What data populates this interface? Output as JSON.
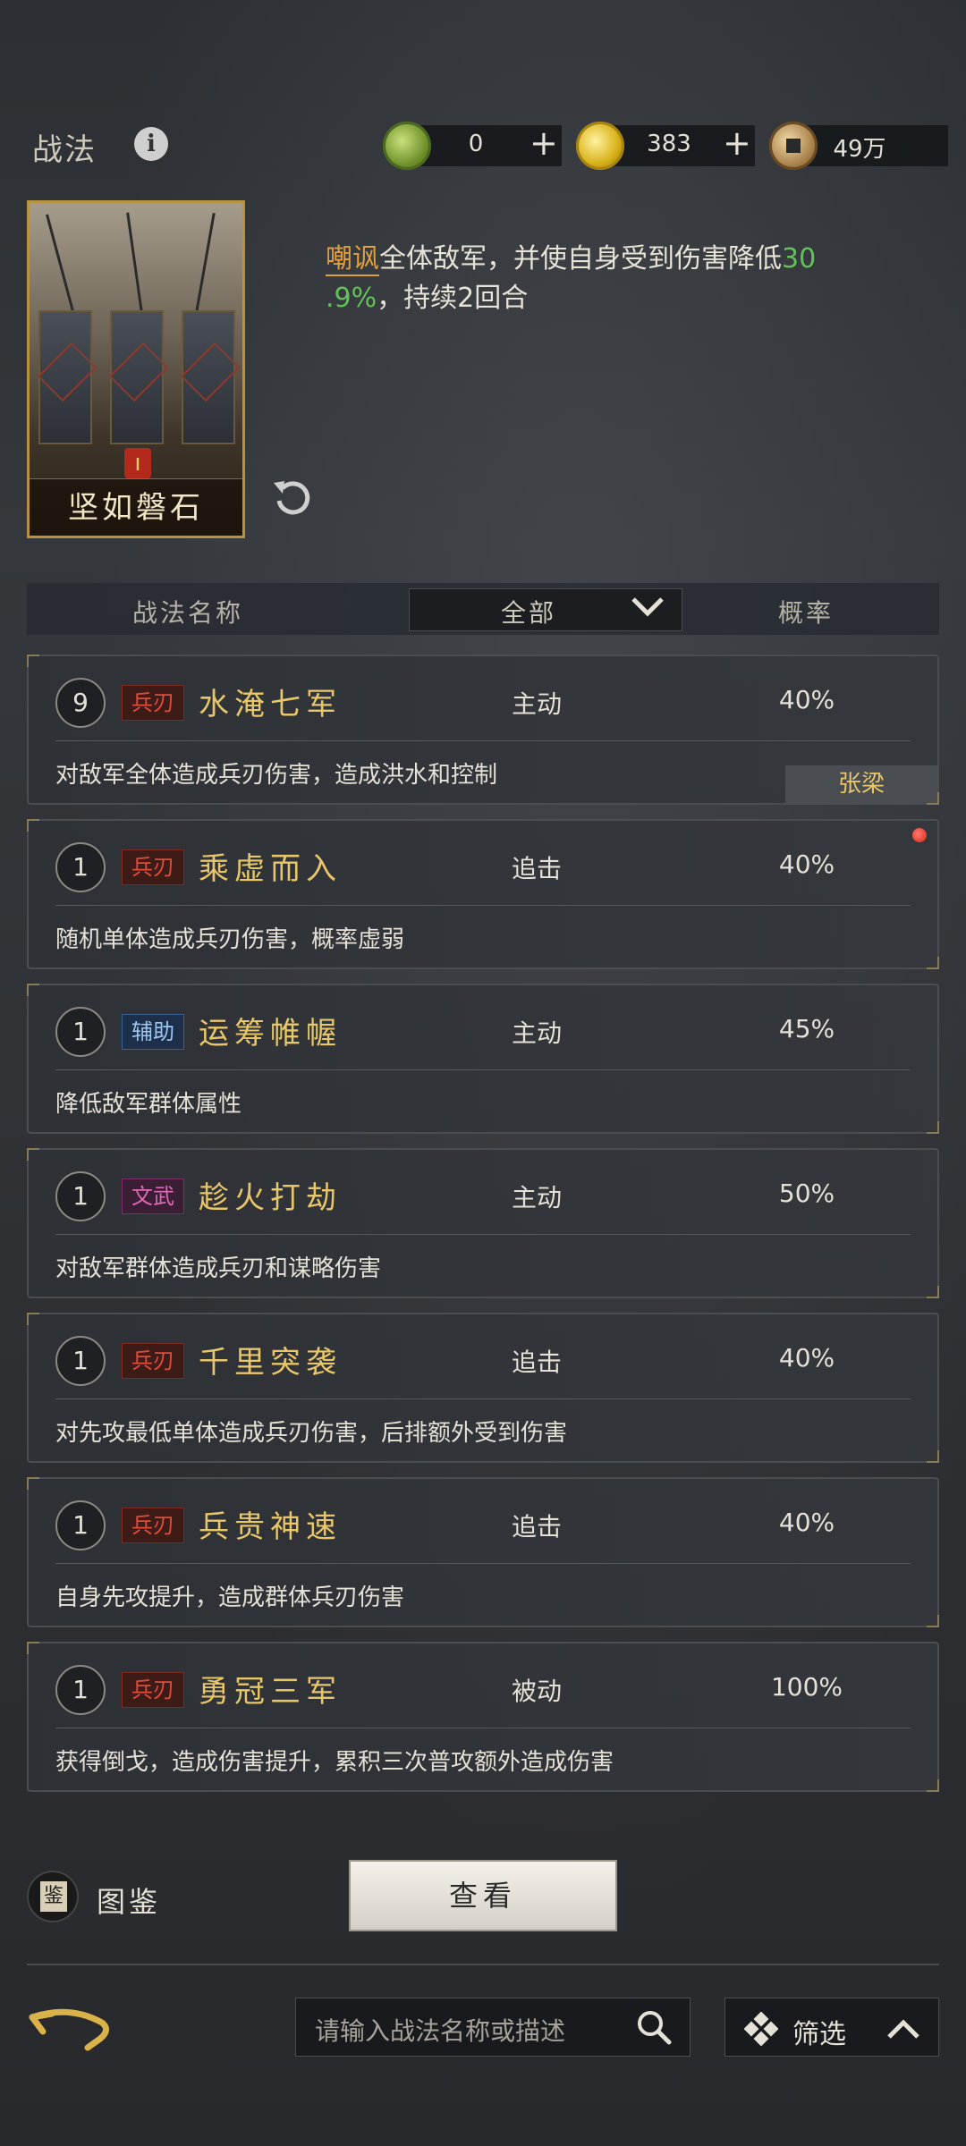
{
  "header": {
    "title": "战法",
    "currencies": [
      {
        "icon": "jade-coin-icon",
        "value": "0",
        "plus": "+"
      },
      {
        "icon": "gold-coin-icon",
        "value": "383",
        "plus": "+"
      },
      {
        "icon": "copper-coin-icon",
        "value": "49万"
      }
    ]
  },
  "featured": {
    "card_name": "坚如磐石",
    "card_grade": "ı",
    "desc_keyword": "嘲讽",
    "desc_part1": "全体敌军，并使自身受到伤害降低",
    "desc_num_a": "30",
    "desc_num_b": ".9%",
    "desc_part2": "，持续2回合"
  },
  "table": {
    "col_name": "战法名称",
    "filter_value": "全部",
    "col_prob": "概率"
  },
  "skills": [
    {
      "level": "9",
      "tag": "兵刃",
      "tag_color": "#e34b39",
      "name": "水淹七军",
      "type": "主动",
      "prob": "40%",
      "desc": "对敌军全体造成兵刃伤害，造成洪水和控制",
      "owner": "张梁"
    },
    {
      "level": "1",
      "tag": "兵刃",
      "tag_color": "#e34b39",
      "name": "乘虚而入",
      "type": "追击",
      "prob": "40%",
      "desc": "随机单体造成兵刃伤害，概率虚弱",
      "new_badge": true
    },
    {
      "level": "1",
      "tag": "辅助",
      "tag_color": "#9cc6f2",
      "name": "运筹帷幄",
      "type": "主动",
      "prob": "45%",
      "desc": "降低敌军群体属性"
    },
    {
      "level": "1",
      "tag": "文武",
      "tag_color": "#e068b8",
      "name": "趁火打劫",
      "type": "主动",
      "prob": "50%",
      "desc": "对敌军群体造成兵刃和谋略伤害"
    },
    {
      "level": "1",
      "tag": "兵刃",
      "tag_color": "#e34b39",
      "name": "千里突袭",
      "type": "追击",
      "prob": "40%",
      "desc": "对先攻最低单体造成兵刃伤害，后排额外受到伤害"
    },
    {
      "level": "1",
      "tag": "兵刃",
      "tag_color": "#e34b39",
      "name": "兵贵神速",
      "type": "追击",
      "prob": "40%",
      "desc": "自身先攻提升，造成群体兵刃伤害"
    },
    {
      "level": "1",
      "tag": "兵刃",
      "tag_color": "#e34b39",
      "name": "勇冠三军",
      "type": "被动",
      "prob": "100%",
      "desc": "获得倒戈，造成伤害提升，累积三次普攻额外造成伤害"
    }
  ],
  "footer": {
    "tujian_label": "图鉴",
    "view_button": "查看",
    "search_placeholder": "请输入战法名称或描述",
    "filter_label": "筛选"
  }
}
